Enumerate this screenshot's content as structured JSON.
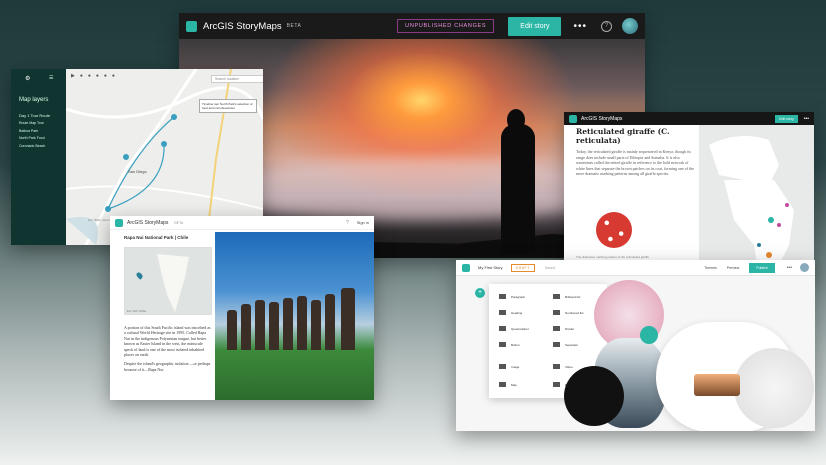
{
  "main_window": {
    "app_title": "ArcGIS StoryMaps",
    "beta_badge": "BETA",
    "status_badge": "UNPUBLISHED CHANGES",
    "edit_button": "Edit story",
    "more_icon": "ellipsis-icon",
    "help_icon": "help-circle-icon"
  },
  "map_window": {
    "sidebar_title": "Map layers",
    "tour_label": "Day 1 Tour Route",
    "layers": [
      "Route Map Tour",
      "Balboa Park",
      "North Park Food",
      "Coronado Beach"
    ],
    "search_placeholder": "Search location",
    "tooltip": "Timeline tour North Park's selection of food and microbreweries",
    "city_label": "San Diego",
    "attribution": "Esri, HERE, Garmin, NGA, USGS, NPS"
  },
  "giraffe_window": {
    "app_title": "ArcGIS StoryMaps",
    "edit_button": "Edit story",
    "heading": "Reticulated giraffe (C. reticulata)",
    "body": "Today, the reticulated giraffe is mainly sequestered in Kenya, though its range does include small parts of Ethiopia and Somalia. It is also sometimes called the netted giraffe in reference to the bold network of white lines that separate the brown patches on its coat, forming one of the more dramatic marking patterns among all giraffe species.",
    "caption": "The distinctive marking pattern of the reticulated giraffe"
  },
  "rapa_window": {
    "app_title": "ArcGIS StoryMaps",
    "beta_badge": "BETA",
    "sign_in": "Sign in",
    "heading": "Rapa Nui National Park | Chile",
    "map_attribution": "Esri, FAO, NOAA",
    "body": "A portion of this South Pacific island was inscribed as a cultural World Heritage site in 1995. Called Rapa Nui in the indigenous Polynesian tongue, but better known as Easter Island in the west, the miniscule speck of land is one of the most isolated inhabited places on earth.",
    "body2": "Despite the island's geographic isolation —or perhaps because of it—Rapa Nui"
  },
  "builder_window": {
    "story_title": "My First Story",
    "draft_badge": "DRAFT",
    "saved_label": "Saved",
    "theme_label": "Themes",
    "preview_label": "Preview",
    "publish_button": "Publish",
    "add_block_icon": "plus-icon",
    "blocks_left": [
      "Paragraph",
      "Heading",
      "Quote/callout",
      "Button",
      "Image",
      "Map"
    ],
    "blocks_right": [
      "Bulleted list",
      "Numbered list",
      "Divider",
      "Separator",
      "Video",
      "Embed"
    ]
  }
}
